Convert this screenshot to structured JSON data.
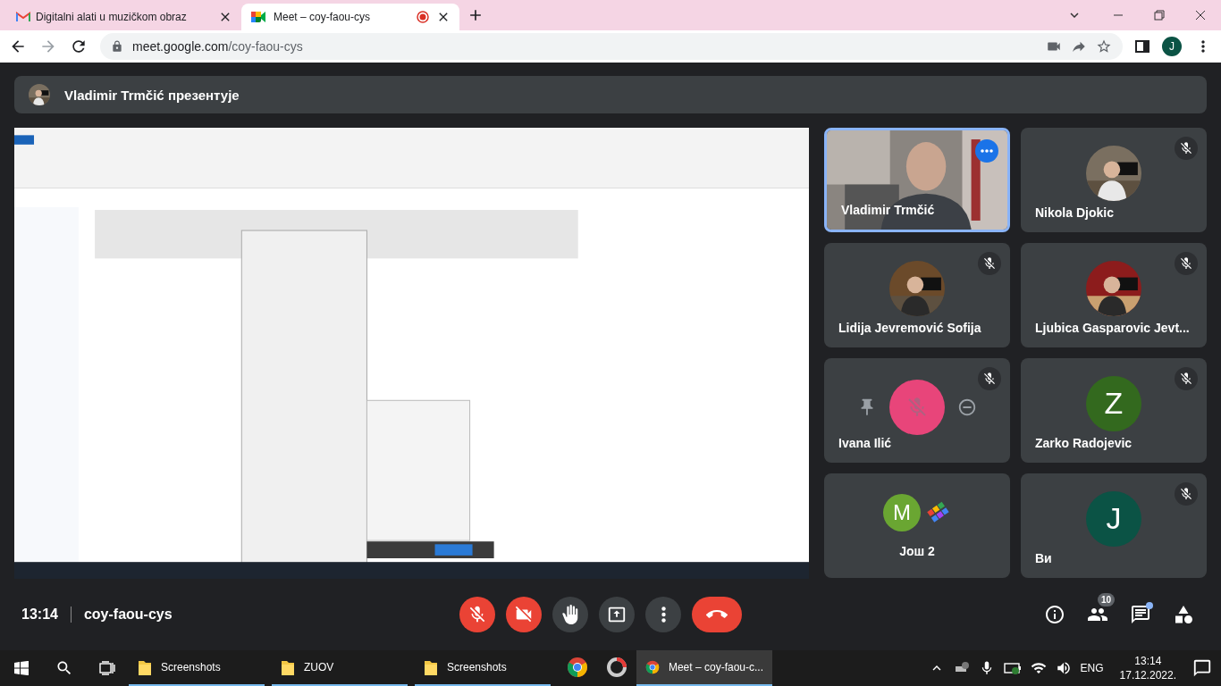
{
  "browser": {
    "tabs": [
      {
        "kind": "gmail",
        "title": "Digitalni alati u muzičkom obraz",
        "selected": false,
        "recording": false
      },
      {
        "kind": "meet",
        "title": "Meet – coy-faou-cys",
        "selected": true,
        "recording": true
      }
    ],
    "url_host": "meet.google.com",
    "url_path": "/coy-faou-cys",
    "profile_initial": "J"
  },
  "presenter_banner": "Vladimir Trmčić презентује",
  "participants": [
    {
      "kind": "video",
      "name": "Vladimir Trmčić",
      "muted": false,
      "active": true
    },
    {
      "name": "Nikola Djokic",
      "muted": true,
      "active": false
    },
    {
      "name": "Lidija Jevremović Sofija",
      "muted": true,
      "active": false
    },
    {
      "name": "Ljubica Gasparovic Jevt...",
      "muted": true,
      "active": false
    },
    {
      "kind": "hover",
      "name": "Ivana Ilić",
      "muted": true,
      "active": false,
      "color": "#e8457a"
    },
    {
      "kind": "initial",
      "name": "Zarko Radojevic",
      "initial": "Z",
      "muted": true,
      "active": false,
      "color": "#33691e"
    },
    {
      "kind": "more",
      "name": "Још 2",
      "initial": "M",
      "muted": false,
      "active": false,
      "color": "#6aa632"
    },
    {
      "kind": "initial",
      "name": "Ви",
      "initial": "J",
      "muted": true,
      "active": false,
      "color": "#0b5345"
    }
  ],
  "footer": {
    "time": "13:14",
    "meeting_code": "coy-faou-cys",
    "controls": [
      {
        "kind": "mic",
        "on": false
      },
      {
        "kind": "camera",
        "on": false
      },
      {
        "kind": "hand",
        "on": false
      },
      {
        "kind": "present",
        "on": false
      },
      {
        "kind": "more",
        "on": false
      },
      {
        "kind": "end",
        "on": false
      }
    ],
    "side_buttons": [
      {
        "kind": "info"
      },
      {
        "kind": "people",
        "badge": "10"
      },
      {
        "kind": "chat",
        "unread": true
      },
      {
        "kind": "activities"
      }
    ]
  },
  "taskbar": {
    "apps": [
      {
        "kind": "folder",
        "label": "Screenshots",
        "open": true,
        "selected": false
      },
      {
        "kind": "folder",
        "label": "ZUOV",
        "open": true,
        "selected": false
      },
      {
        "kind": "folder",
        "label": "Screenshots",
        "open": true,
        "selected": false
      },
      {
        "kind": "chrome",
        "open": false,
        "selected": false
      },
      {
        "kind": "capture",
        "open": false,
        "selected": false
      },
      {
        "kind": "chrome",
        "label": "Meet – coy-faou-c...",
        "open": true,
        "selected": true
      }
    ],
    "language": "ENG",
    "time": "13:14",
    "date": "17.12.2022."
  }
}
